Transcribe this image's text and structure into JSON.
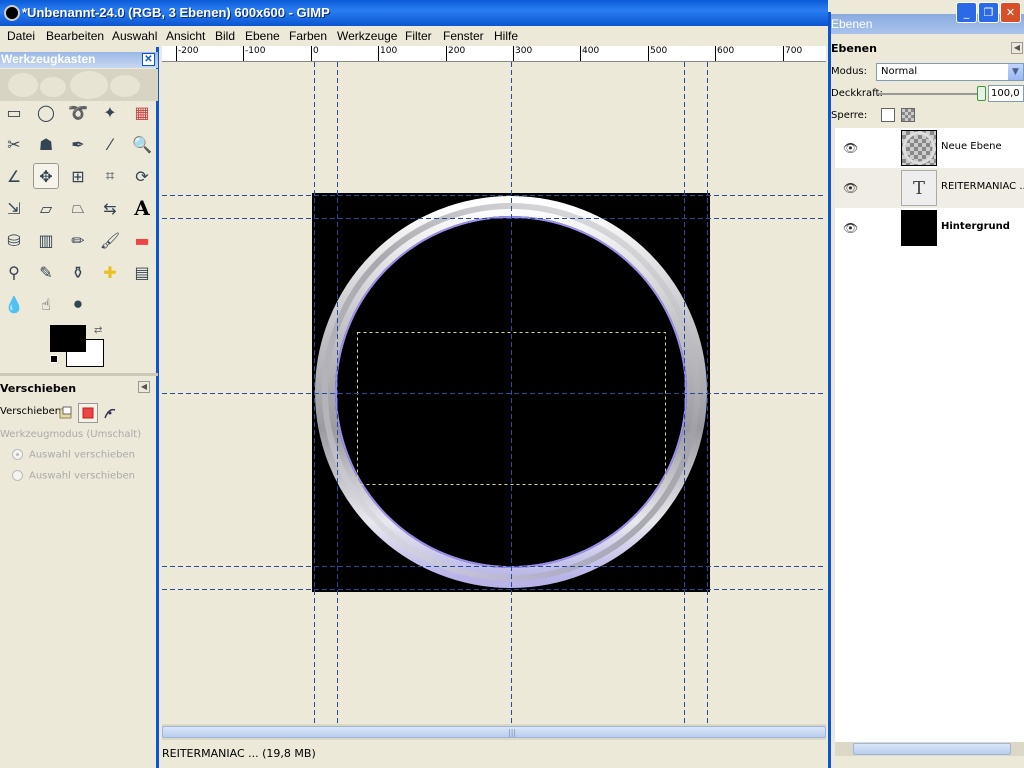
{
  "window": {
    "title": "*Unbenannt-24.0 (RGB, 3 Ebenen) 600x600 - GIMP"
  },
  "menu": [
    "Datei",
    "Bearbeiten",
    "Auswahl",
    "Ansicht",
    "Bild",
    "Ebene",
    "Farben",
    "Werkzeuge",
    "Filter",
    "Fenster",
    "Hilfe"
  ],
  "toolbox": {
    "title": "Werkzeugkasten",
    "close_label": "✕",
    "tools": [
      "rect-select-icon",
      "ellipse-select-icon",
      "lasso-icon",
      "fuzzy-select-icon",
      "color-select-icon",
      "scissors-icon",
      "foreground-select-icon",
      "paths-icon",
      "color-picker-icon",
      "zoom-icon",
      "measure-icon",
      "move-icon",
      "align-icon",
      "crop-icon",
      "rotate-icon",
      "scale-icon",
      "shear-icon",
      "perspective-icon",
      "flip-icon",
      "text-icon",
      "bucket-fill-icon",
      "blend-icon",
      "pencil-icon",
      "paintbrush-icon",
      "eraser-icon",
      "airbrush-icon",
      "ink-icon",
      "clone-icon",
      "heal-icon",
      "perspective-clone-icon",
      "blur-icon",
      "smudge-icon",
      "dodge-burn-icon"
    ],
    "active_tool": "move-icon",
    "options": {
      "header": "Verschieben",
      "move_label": "Verschieben:",
      "mode_label": "Werkzeugmodus (Umschalt)",
      "radio1": "Auswahl verschieben",
      "radio2": "Auswahl verschieben"
    }
  },
  "ruler": {
    "labels": [
      "-200",
      "-100",
      "0",
      "100",
      "200",
      "300",
      "400",
      "500",
      "600",
      "700"
    ]
  },
  "status": {
    "text": "REITERMANIAC ... (19,8 MB)"
  },
  "layers_dock": {
    "window_title": "Ebenen",
    "subtitle": "Ebenen",
    "mode_label": "Modus:",
    "mode_value": "Normal",
    "opacity_label": "Deckkraft:",
    "opacity_value": "100,0",
    "lock_label": "Sperre:",
    "layers": [
      {
        "name": "Neue Ebene",
        "type": "transparent",
        "bold": false
      },
      {
        "name": "REITERMANIAC ...",
        "type": "text",
        "bold": false
      },
      {
        "name": "Hintergrund",
        "type": "black",
        "bold": true
      }
    ]
  }
}
